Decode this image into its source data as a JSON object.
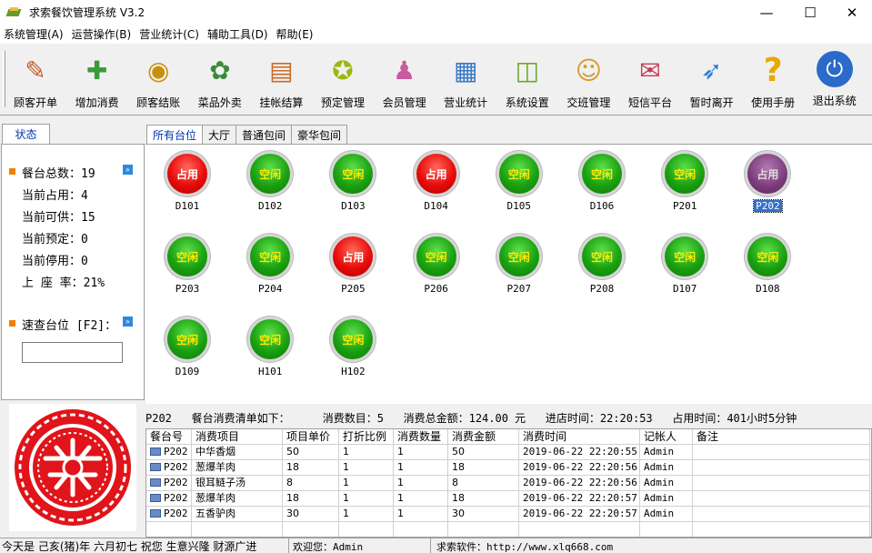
{
  "window": {
    "title": "求索餐饮管理系统 V3.2",
    "minimize": "—",
    "maximize": "☐",
    "close": "✕"
  },
  "menu": [
    "系统管理(A)",
    "运营操作(B)",
    "营业统计(C)",
    "辅助工具(D)",
    "帮助(E)"
  ],
  "toolbar": [
    {
      "label": "顾客开单",
      "icon": "pencil-chart-icon"
    },
    {
      "label": "增加消费",
      "icon": "add-consumption-icon"
    },
    {
      "label": "顾客结账",
      "icon": "coins-icon"
    },
    {
      "label": "菜品外卖",
      "icon": "sale-tag-icon"
    },
    {
      "label": "挂帐结算",
      "icon": "ledger-icon"
    },
    {
      "label": "预定管理",
      "icon": "clock-star-icon"
    },
    {
      "label": "会员管理",
      "icon": "members-icon"
    },
    {
      "label": "营业统计",
      "icon": "stats-chart-icon"
    },
    {
      "label": "系统设置",
      "icon": "settings-cube-icon"
    },
    {
      "label": "交班管理",
      "icon": "shift-people-icon"
    },
    {
      "label": "短信平台",
      "icon": "sms-envelope-icon"
    },
    {
      "label": "暂时离开",
      "icon": "running-man-icon"
    },
    {
      "label": "使用手册",
      "icon": "question-mark-icon"
    },
    {
      "label": "退出系统",
      "icon": "power-icon"
    }
  ],
  "left": {
    "tab": "状态",
    "stats": [
      {
        "label": "餐台总数：",
        "value": "19"
      },
      {
        "label": "当前占用：",
        "value": "4"
      },
      {
        "label": "当前可供：",
        "value": "15"
      },
      {
        "label": "当前预定：",
        "value": "0"
      },
      {
        "label": "当前停用：",
        "value": "0"
      },
      {
        "label": "上 座 率：",
        "value": "21%"
      }
    ],
    "quick_label": "速查台位 [F2]：",
    "quick_value": "",
    "seal_char": "招财进宝"
  },
  "tabs": [
    "所有台位",
    "大厅",
    "普通包间",
    "豪华包间"
  ],
  "tables": [
    {
      "name": "D101",
      "status": "占用",
      "state": "busy"
    },
    {
      "name": "D102",
      "status": "空闲",
      "state": "free"
    },
    {
      "name": "D103",
      "status": "空闲",
      "state": "free"
    },
    {
      "name": "D104",
      "status": "占用",
      "state": "busy"
    },
    {
      "name": "D105",
      "status": "空闲",
      "state": "free"
    },
    {
      "name": "D106",
      "status": "空闲",
      "state": "free"
    },
    {
      "name": "P201",
      "status": "空闲",
      "state": "free"
    },
    {
      "name": "P202",
      "status": "占用",
      "state": "sel"
    },
    {
      "name": "P203",
      "status": "空闲",
      "state": "free"
    },
    {
      "name": "P204",
      "status": "空闲",
      "state": "free"
    },
    {
      "name": "P205",
      "status": "占用",
      "state": "busy"
    },
    {
      "name": "P206",
      "status": "空闲",
      "state": "free"
    },
    {
      "name": "P207",
      "status": "空闲",
      "state": "free"
    },
    {
      "name": "P208",
      "status": "空闲",
      "state": "free"
    },
    {
      "name": "D107",
      "status": "空闲",
      "state": "free"
    },
    {
      "name": "D108",
      "status": "空闲",
      "state": "free"
    },
    {
      "name": "D109",
      "status": "空闲",
      "state": "free"
    },
    {
      "name": "H101",
      "status": "空闲",
      "state": "free"
    },
    {
      "name": "H102",
      "status": "空闲",
      "state": "free"
    }
  ],
  "summary": "P202   餐台消费清单如下：     消费数目：5   消费总金额：124.00 元   进店时间：22:20:53   占用时间：401小时5分钟",
  "grid": {
    "headers": [
      "餐台号",
      "消费项目",
      "项目单价",
      "打折比例",
      "消费数量",
      "消费金额",
      "消费时间",
      "记帐人",
      "备注"
    ],
    "rows": [
      [
        "P202",
        "中华香烟",
        "50",
        "1",
        "1",
        "50",
        "2019-06-22 22:20:55",
        "Admin",
        ""
      ],
      [
        "P202",
        "葱爆羊肉",
        "18",
        "1",
        "1",
        "18",
        "2019-06-22 22:20:56",
        "Admin",
        ""
      ],
      [
        "P202",
        "银耳鲢子汤",
        "8",
        "1",
        "1",
        "8",
        "2019-06-22 22:20:56",
        "Admin",
        ""
      ],
      [
        "P202",
        "葱爆羊肉",
        "18",
        "1",
        "1",
        "18",
        "2019-06-22 22:20:57",
        "Admin",
        ""
      ],
      [
        "P202",
        "五香驴肉",
        "30",
        "1",
        "1",
        "30",
        "2019-06-22 22:20:57",
        "Admin",
        ""
      ]
    ]
  },
  "status": {
    "left": "今天是 己亥(猪)年 六月初七 祝您 生意兴隆 财源广进",
    "welcome": "欢迎您：Admin",
    "site": "求索软件：http://www.xlq668.com"
  },
  "colors": {
    "busy": "#e80a0a",
    "free": "#1aa010",
    "selected": "#7a3a7a",
    "link": "#0033aa"
  }
}
